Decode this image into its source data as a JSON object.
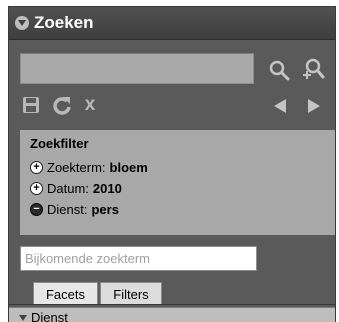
{
  "panel": {
    "title": "Zoeken",
    "collapse_icon": "triangle-down-icon"
  },
  "search": {
    "value": "",
    "placeholder": "",
    "search_icon": "search-icon",
    "advanced_search_icon": "search-plus-icon"
  },
  "toolbar": {
    "save_icon": "save-icon",
    "refresh_icon": "refresh-icon",
    "clear_icon": "clear-icon",
    "clear_label": "x",
    "prev_icon": "prev-arrow-icon",
    "next_icon": "next-arrow-icon"
  },
  "filters": {
    "title": "Zoekfilter",
    "items": [
      {
        "label": "Zoekterm:",
        "value": "bloem",
        "state": "plus"
      },
      {
        "label": "Datum:",
        "value": "2010",
        "state": "plus"
      },
      {
        "label": "Dienst:",
        "value": "pers",
        "state": "minus"
      }
    ]
  },
  "extra_term": {
    "value": "",
    "placeholder": "Bijkomende zoekterm"
  },
  "tabs": [
    {
      "label": "Facets",
      "active": true
    },
    {
      "label": "Filters",
      "active": false
    }
  ],
  "facets": {
    "section_label": "Dienst"
  },
  "colors": {
    "panel_bg": "#5a5a5a",
    "filter_bg": "#a8a8a8",
    "icon_gray": "#b8b8b8"
  }
}
